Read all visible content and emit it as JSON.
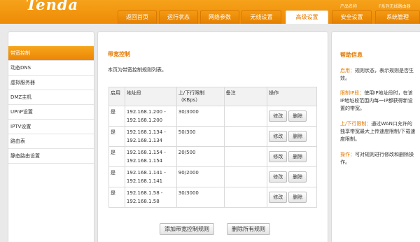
{
  "header": {
    "logo": "Tenda",
    "product_label": "产品名称",
    "product_name": "F系列无线路由器"
  },
  "nav": {
    "tabs": [
      {
        "label": "返回首页"
      },
      {
        "label": "运行状态"
      },
      {
        "label": "网络参数"
      },
      {
        "label": "无线设置"
      },
      {
        "label": "高级设置",
        "active": true
      },
      {
        "label": "安全设置"
      },
      {
        "label": "系统管理"
      }
    ]
  },
  "sidebar": {
    "items": [
      {
        "label": "带宽控制",
        "active": true
      },
      {
        "label": "动态DNS"
      },
      {
        "label": "虚拟服务器"
      },
      {
        "label": "DMZ主机"
      },
      {
        "label": "UPnP设置"
      },
      {
        "label": "IPTV设置"
      },
      {
        "label": "路由表"
      },
      {
        "label": "静态路由设置"
      }
    ]
  },
  "main": {
    "title": "带宽控制",
    "description": "本页为带宽控制规则列表。",
    "table": {
      "headers": {
        "enable": "启用",
        "address": "地址段",
        "limit_line1": "上/下行限制",
        "limit_line2": "（KBps）",
        "note": "备注",
        "action": "操作"
      },
      "rows": [
        {
          "enable": "是",
          "addr1": "192.168.1.200 -",
          "addr2": "192.168.1.200",
          "limit": "30/3000",
          "note": ""
        },
        {
          "enable": "是",
          "addr1": "192.168.1.134 -",
          "addr2": "192.168.1.134",
          "limit": "50/300",
          "note": ""
        },
        {
          "enable": "是",
          "addr1": "192.168.1.154 -",
          "addr2": "192.168.1.154",
          "limit": "20/500",
          "note": ""
        },
        {
          "enable": "是",
          "addr1": "192.168.1.141 -",
          "addr2": "192.168.1.141",
          "limit": "90/2000",
          "note": ""
        },
        {
          "enable": "是",
          "addr1": "192.168.1.58 -",
          "addr2": "192.168.1.58",
          "limit": "30/3000",
          "note": ""
        }
      ],
      "edit_label": "修改",
      "delete_label": "删除"
    },
    "add_button": "添加带宽控制规则",
    "delete_all_button": "删除所有规则"
  },
  "help": {
    "title": "帮助信息",
    "items": [
      {
        "key": "启用：",
        "text": "规则状态，表示规则是否生效。"
      },
      {
        "key": "限制IP段：",
        "text": "使用IP地址段时，在该IP地址段范围内每一IP都获得新设置的带宽。"
      },
      {
        "key": "上/下行限制：",
        "text": "通过WAN口允许的独享带宽最大上传速度限制/下载速度限制。"
      },
      {
        "key": "操作：",
        "text": "可对规则进行修改和删除操作。"
      }
    ]
  }
}
